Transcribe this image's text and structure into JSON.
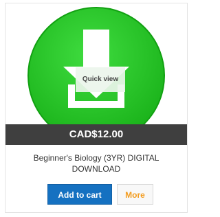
{
  "product": {
    "quick_view_label": "Quick view",
    "price": "CAD$12.00",
    "title": "Beginner's Biology (3YR) DIGITAL DOWNLOAD"
  },
  "actions": {
    "add_to_cart_label": "Add to cart",
    "more_label": "More"
  },
  "icons": {
    "product_image": "download-icon"
  },
  "colors": {
    "icon_green": "#22c322",
    "price_bar": "#3f3f3f",
    "add_to_cart": "#1571c1",
    "more_text": "#f39c1f"
  }
}
